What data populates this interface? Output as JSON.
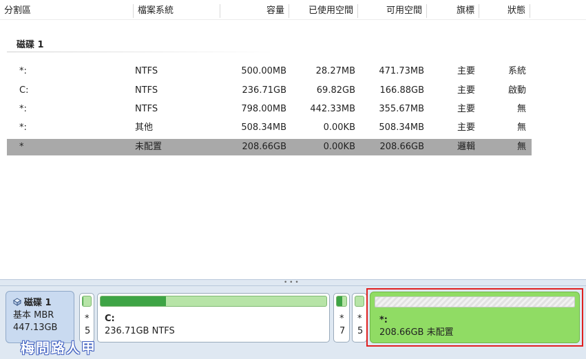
{
  "columns": {
    "partition": "分割區",
    "filesystem": "檔案系統",
    "capacity": "容量",
    "used": "已使用空間",
    "free": "可用空間",
    "flag": "旗標",
    "status": "狀態"
  },
  "disk_title": "磁碟 1",
  "rows": [
    {
      "part": "*:",
      "fs": "NTFS",
      "cap": "500.00MB",
      "used": "28.27MB",
      "free": "471.73MB",
      "flag": "主要",
      "status": "系統"
    },
    {
      "part": "C:",
      "fs": "NTFS",
      "cap": "236.71GB",
      "used": "69.82GB",
      "free": "166.88GB",
      "flag": "主要",
      "status": "啟動"
    },
    {
      "part": "*:",
      "fs": "NTFS",
      "cap": "798.00MB",
      "used": "442.33MB",
      "free": "355.67MB",
      "flag": "主要",
      "status": "無"
    },
    {
      "part": "*:",
      "fs": "其他",
      "cap": "508.34MB",
      "used": "0.00KB",
      "free": "508.34MB",
      "flag": "主要",
      "status": "無"
    },
    {
      "part": "*",
      "fs": "未配置",
      "cap": "208.66GB",
      "used": "0.00KB",
      "free": "208.66GB",
      "flag": "邏輯",
      "status": "無"
    }
  ],
  "map": {
    "disk_name": "磁碟 1",
    "disk_type": "基本 MBR",
    "disk_size": "447.13GB",
    "p1": {
      "label": "*",
      "size": "5",
      "fill": 0.06
    },
    "p2": {
      "label": "C:",
      "size": "236.71GB NTFS",
      "fill": 0.29
    },
    "p3": {
      "label": "*",
      "size": "7",
      "fill": 0.55
    },
    "p4": {
      "label": "*",
      "size": "5",
      "fill": 0.0
    },
    "unalloc": {
      "label": "*:",
      "size": "208.66GB 未配置"
    }
  },
  "watermark": "梅問路人甲",
  "colors": {
    "selected_row": "#a9a9a9",
    "used_fill": "#3ea445",
    "unallocated": "#90dc64",
    "highlight_border": "#e02020"
  }
}
